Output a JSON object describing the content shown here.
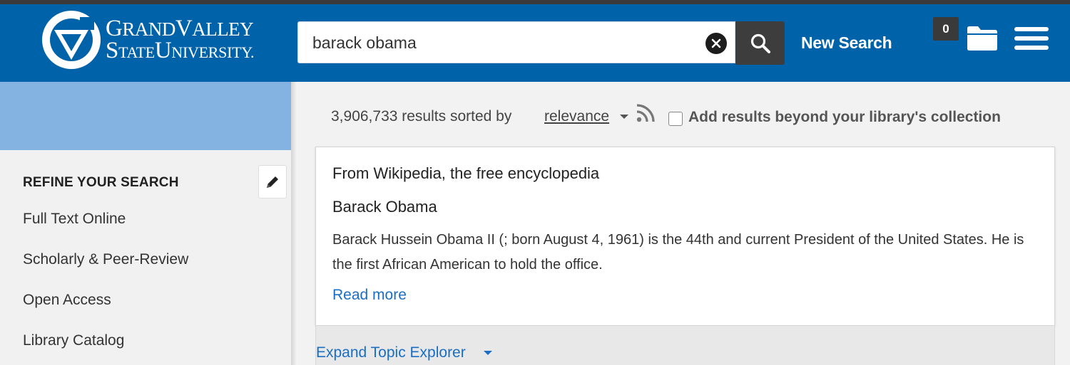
{
  "header": {
    "logo": {
      "line1_cap1": "G",
      "line1_rest": "RAND",
      "line1_cap2": "V",
      "line1_rest2": "ALLEY",
      "line2_cap1": "S",
      "line2_rest": "TATE",
      "line2_cap2": "U",
      "line2_rest2": "NIVERSITY."
    },
    "search_value": "barack obama",
    "new_search_label": "New Search",
    "folder_count": "0",
    "colors": {
      "header_bg": "#0062a8",
      "search_button_bg": "#3d3d3d"
    },
    "icons": [
      "gvsu-logo-icon",
      "clear-icon",
      "search-icon",
      "folder-icon",
      "menu-icon"
    ]
  },
  "sidebar": {
    "title": "REFINE YOUR SEARCH",
    "edit_icon": "pencil-icon",
    "facets": [
      "Full Text Online",
      "Scholarly & Peer-Review",
      "Open Access",
      "Library Catalog"
    ],
    "colors": {
      "top_band": "#84b3e1"
    }
  },
  "results": {
    "count_text": "3,906,733 results sorted by",
    "sort_value": "relevance",
    "rss_icon": "rss-icon",
    "beyond_label": "Add results beyond your library's collection",
    "beyond_checked": false
  },
  "wiki_card": {
    "source": "From Wikipedia, the free encyclopedia",
    "title": "Barack Obama",
    "description": "Barack Hussein Obama II (; born August 4, 1961) is the 44th and current President of the United States. He is the first African American to hold the office.",
    "read_more": "Read more",
    "link_color": "#1a6fc4"
  },
  "topic_explorer": {
    "label": "Expand Topic Explorer"
  }
}
